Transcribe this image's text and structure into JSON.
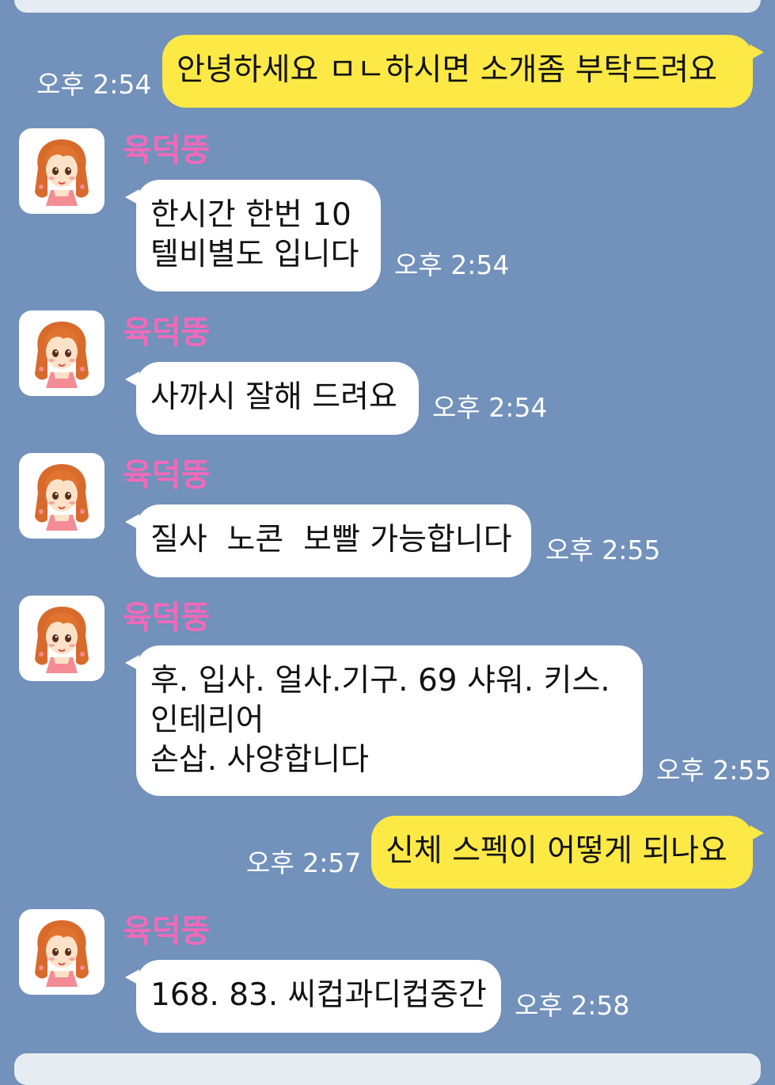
{
  "chat": {
    "sender_name": "육덕뚱",
    "messages": [
      {
        "id": 1,
        "from": "me",
        "text": "안녕하세요 ㅁㄴ하시면 소개좀 부탁드려요",
        "time": "오후 2:54"
      },
      {
        "id": 2,
        "from": "other",
        "text": "한시간 한번 10\n텔비별도 입니다",
        "time": "오후 2:54"
      },
      {
        "id": 3,
        "from": "other",
        "text": "사까시 잘해 드려요",
        "time": "오후 2:54"
      },
      {
        "id": 4,
        "from": "other",
        "text": "질사  노콘  보빨 가능합니다",
        "time": "오후 2:55"
      },
      {
        "id": 5,
        "from": "other",
        "text": "후. 입사. 얼사.기구. 69 샤워. 키스.\n인테리어\n손삽. 사양합니다",
        "time": "오후 2:55"
      },
      {
        "id": 6,
        "from": "me",
        "text": "신체 스펙이 어떻게 되나요",
        "time": "오후 2:57"
      },
      {
        "id": 7,
        "from": "other",
        "text": "168. 83. 씨컵과디컵중간",
        "time": "오후 2:58"
      }
    ]
  },
  "colors": {
    "background": "#7291bb",
    "my_bubble": "#fce945",
    "other_bubble": "#ffffff",
    "sender_name": "#f16ab9",
    "timestamp": "#ffffff"
  },
  "icons": {
    "avatar": "profile-avatar-girl-icon"
  }
}
